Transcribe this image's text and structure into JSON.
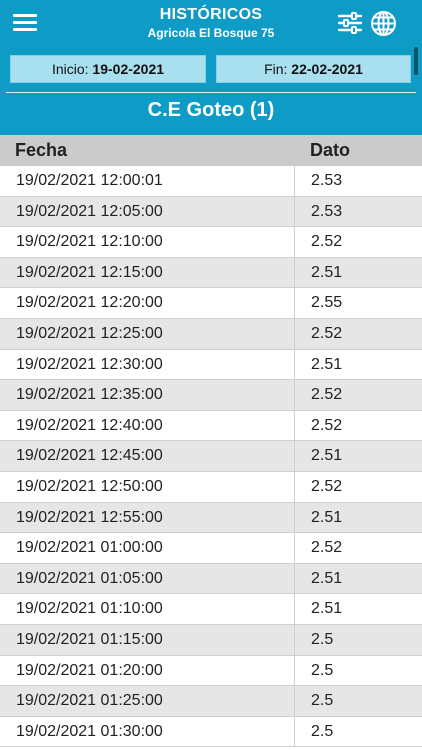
{
  "header": {
    "title": "HISTÓRICOS",
    "subtitle": "Agricola El Bosque 75"
  },
  "filters": {
    "start_label": "Inicio:",
    "start_date": "19-02-2021",
    "end_label": "Fin:",
    "end_date": "22-02-2021"
  },
  "section": {
    "title": "C.E Goteo (1)"
  },
  "table": {
    "columns": [
      "Fecha",
      "Dato"
    ],
    "rows": [
      {
        "fecha": "19/02/2021 12:00:01",
        "dato": "2.53"
      },
      {
        "fecha": "19/02/2021 12:05:00",
        "dato": "2.53"
      },
      {
        "fecha": "19/02/2021 12:10:00",
        "dato": "2.52"
      },
      {
        "fecha": "19/02/2021 12:15:00",
        "dato": "2.51"
      },
      {
        "fecha": "19/02/2021 12:20:00",
        "dato": "2.55"
      },
      {
        "fecha": "19/02/2021 12:25:00",
        "dato": "2.52"
      },
      {
        "fecha": "19/02/2021 12:30:00",
        "dato": "2.51"
      },
      {
        "fecha": "19/02/2021 12:35:00",
        "dato": "2.52"
      },
      {
        "fecha": "19/02/2021 12:40:00",
        "dato": "2.52"
      },
      {
        "fecha": "19/02/2021 12:45:00",
        "dato": "2.51"
      },
      {
        "fecha": "19/02/2021 12:50:00",
        "dato": "2.52"
      },
      {
        "fecha": "19/02/2021 12:55:00",
        "dato": "2.51"
      },
      {
        "fecha": "19/02/2021 01:00:00",
        "dato": "2.52"
      },
      {
        "fecha": "19/02/2021 01:05:00",
        "dato": "2.51"
      },
      {
        "fecha": "19/02/2021 01:10:00",
        "dato": "2.51"
      },
      {
        "fecha": "19/02/2021 01:15:00",
        "dato": "2.5"
      },
      {
        "fecha": "19/02/2021 01:20:00",
        "dato": "2.5"
      },
      {
        "fecha": "19/02/2021 01:25:00",
        "dato": "2.5"
      },
      {
        "fecha": "19/02/2021 01:30:00",
        "dato": "2.5"
      }
    ]
  },
  "icons": {
    "menu": "hamburger-menu-icon",
    "filter": "sliders-filter-icon",
    "language": "globe-icon"
  },
  "colors": {
    "primary": "#0e9cc6",
    "date_box": "#a9e0ef",
    "table_header": "#cbcbcb",
    "row_alt": "#e6e6e6"
  }
}
